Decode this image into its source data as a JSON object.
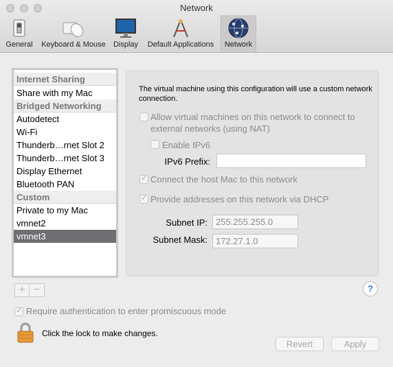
{
  "window": {
    "title": "Network"
  },
  "toolbar": {
    "items": [
      {
        "label": "General",
        "icon": "general-switch-icon"
      },
      {
        "label": "Keyboard & Mouse",
        "icon": "keyboard-mouse-icon"
      },
      {
        "label": "Display",
        "icon": "display-icon"
      },
      {
        "label": "Default Applications",
        "icon": "default-applications-icon"
      },
      {
        "label": "Network",
        "icon": "network-globe-icon",
        "selected": true
      }
    ]
  },
  "sidebar": {
    "groups": [
      {
        "label": "Internet Sharing",
        "items": [
          "Share with my Mac"
        ]
      },
      {
        "label": "Bridged Networking",
        "items": [
          "Autodetect",
          "Wi-Fi",
          "Thunderb…rnet Slot 2",
          "Thunderb…rnet Slot 3",
          "Display Ethernet",
          "Bluetooth PAN"
        ]
      },
      {
        "label": "Custom",
        "items": [
          "Private to my Mac",
          "vmnet2",
          "vmnet3"
        ]
      }
    ],
    "selected": "vmnet3",
    "add_label": "+",
    "remove_label": "−"
  },
  "panel": {
    "description": "The virtual machine using this configuration will use a custom network connection.",
    "allow_nat": {
      "label": "Allow virtual machines on this network to connect to external networks (using NAT)",
      "checked": false
    },
    "enable_ipv6": {
      "label": "Enable IPv6",
      "checked": false
    },
    "ipv6_prefix": {
      "label": "IPv6 Prefix:",
      "value": ""
    },
    "connect_host": {
      "label": "Connect the host Mac to this network",
      "checked": true
    },
    "dhcp": {
      "label": "Provide addresses on this network via DHCP",
      "checked": true
    },
    "subnet_ip": {
      "label": "Subnet IP:",
      "value": "255.255.255.0"
    },
    "subnet_mask": {
      "label": "Subnet Mask:",
      "value": "172.27.1.0"
    }
  },
  "footer": {
    "help_label": "?",
    "require_auth": {
      "label": "Require authentication to enter promiscuous mode",
      "checked": true
    },
    "lock_text": "Click the lock to make changes.",
    "revert_label": "Revert",
    "apply_label": "Apply"
  }
}
